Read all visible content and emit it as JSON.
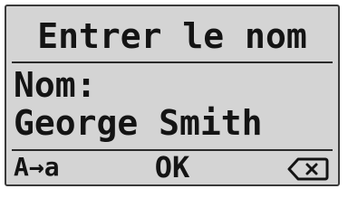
{
  "screen": {
    "title": "Entrer le nom",
    "field_label": "Nom:",
    "field_value": "George Smith"
  },
  "softkeys": {
    "left_label": "A→a",
    "center_label": "OK",
    "right_icon": "backspace-icon"
  }
}
